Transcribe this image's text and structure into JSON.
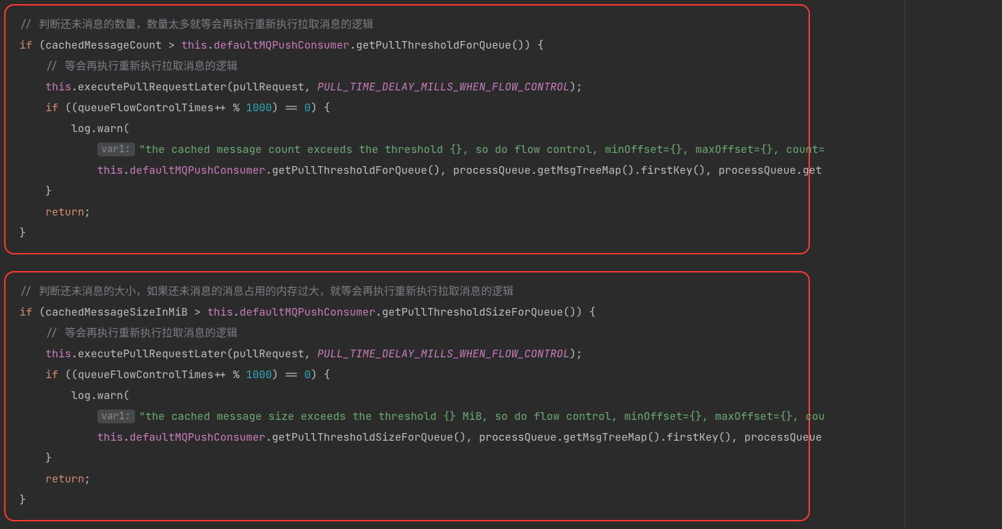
{
  "colors": {
    "background": "#2b2b2b",
    "boxBorder": "#ff3b30",
    "comment": "#7a7e85",
    "keyword": "#cf8e6d",
    "thisRef": "#c77dbb",
    "field": "#c77dbb",
    "method": "#56a8f5",
    "string": "#6aab73",
    "number": "#2aabb8",
    "constant": "#c77dbb",
    "hintBg": "#46484a",
    "hintFg": "#858a91",
    "default": "#bcbec4"
  },
  "hint1": "var1:",
  "hint2": "var1:",
  "block1": {
    "c1": "// 判断还未消息的数量，数量太多就等会再执行重新执行拉取消息的逻辑",
    "if": "if",
    "open": " (cachedMessageCount > ",
    "this1": "this",
    "dot1": ".",
    "field1": "defaultMQPushConsumer",
    "dot2": ".",
    "m1": "getPullThresholdForQueue",
    "tail1": "()) {",
    "c2": "// 等会再执行重新执行拉取消息的逻辑",
    "this2": "this",
    "dot3": ".",
    "m2": "executePullRequestLater",
    "args2a": "(pullRequest, ",
    "const2": "PULL_TIME_DELAY_MILLS_WHEN_FLOW_CONTROL",
    "args2b": ");",
    "if2": "if",
    "cond3a": " ((",
    "ident3": "queueFlowControlTimes",
    "cond3b": "++ % ",
    "num3": "1000",
    "cond3c": ") == ",
    "num3z": "0",
    "cond3d": ") {",
    "log": "log",
    "dotL": ".",
    "warn": "warn",
    "warnOpen": "(",
    "str": "\"the cached message count exceeds the threshold {}, so do flow control, minOffset={}, maxOffset={}, count=",
    "this3": "this",
    "dot4": ".",
    "field2": "defaultMQPushConsumer",
    "dot5": ".",
    "m3": "getPullThresholdForQueue",
    "tail3": "(), processQueue.getMsgTreeMap().firstKey(), processQueue.get",
    "close1": "}",
    "ret": "return",
    "retSemi": ";",
    "close2": "}"
  },
  "block2": {
    "c1": "// 判断还未消息的大小，如果还未消息的消息占用的内存过大，就等会再执行重新执行拉取消息的逻辑",
    "if": "if",
    "open": " (cachedMessageSizeInMiB > ",
    "this1": "this",
    "dot1": ".",
    "field1": "defaultMQPushConsumer",
    "dot2": ".",
    "m1": "getPullThresholdSizeForQueue",
    "tail1": "()) {",
    "c2": "// 等会再执行重新执行拉取消息的逻辑",
    "this2": "this",
    "dot3": ".",
    "m2": "executePullRequestLater",
    "args2a": "(pullRequest, ",
    "const2": "PULL_TIME_DELAY_MILLS_WHEN_FLOW_CONTROL",
    "args2b": ");",
    "if2": "if",
    "cond3a": " ((",
    "ident3": "queueFlowControlTimes",
    "cond3b": "++ % ",
    "num3": "1000",
    "cond3c": ") == ",
    "num3z": "0",
    "cond3d": ") {",
    "log": "log",
    "dotL": ".",
    "warn": "warn",
    "warnOpen": "(",
    "str": "\"the cached message size exceeds the threshold {} MiB, so do flow control, minOffset={}, maxOffset={}, cou",
    "this3": "this",
    "dot4": ".",
    "field2": "defaultMQPushConsumer",
    "dot5": ".",
    "m3": "getPullThresholdSizeForQueue",
    "tail3": "(), processQueue.getMsgTreeMap().firstKey(), processQueue",
    "close1": "}",
    "ret": "return",
    "retSemi": ";",
    "close2": "}"
  }
}
